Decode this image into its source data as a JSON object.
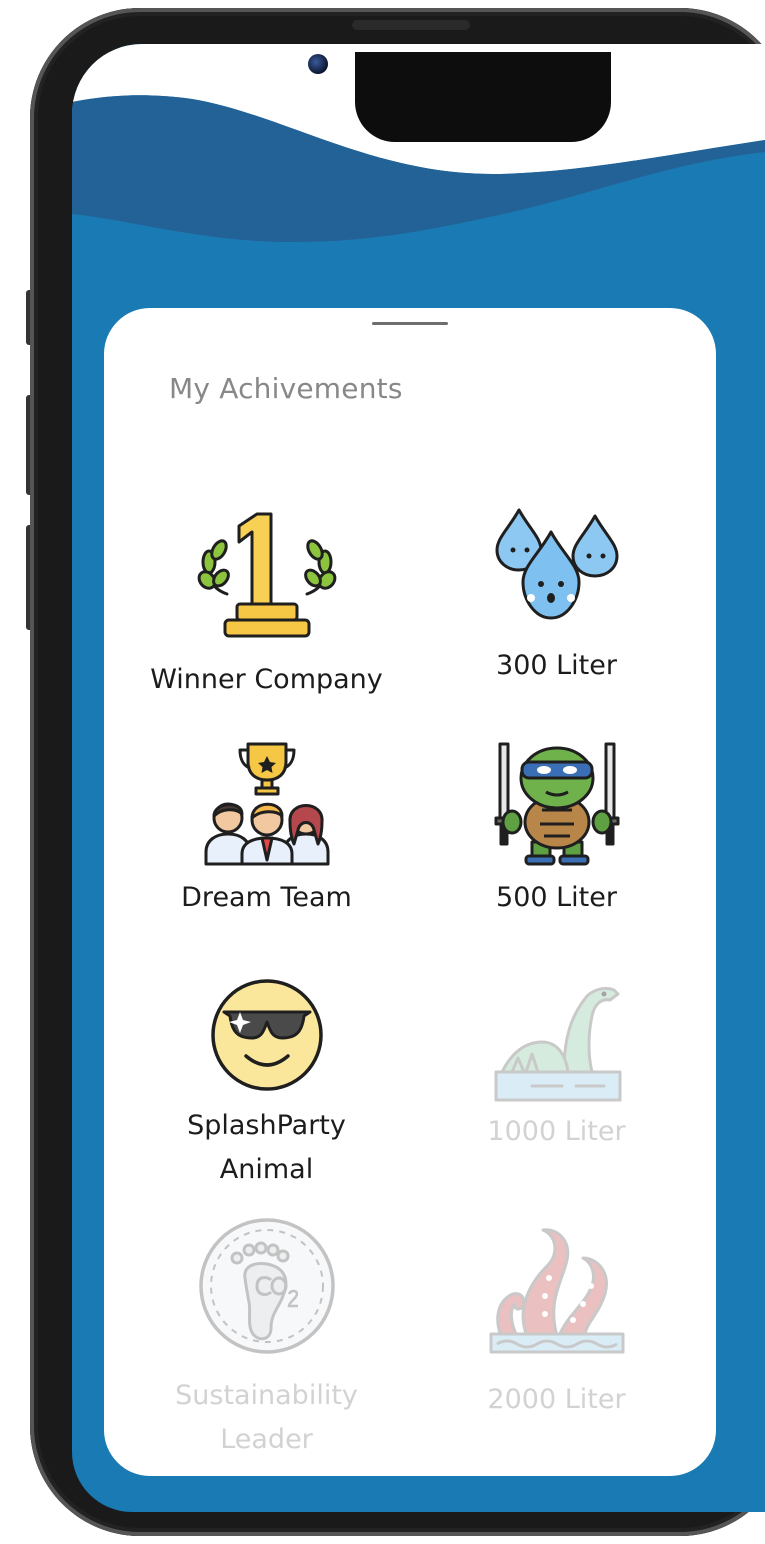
{
  "page": {
    "title": "My Achivements"
  },
  "colors": {
    "screen_blue": "#1a7ab3",
    "wave_dark": "#236296",
    "card_bg": "#ffffff",
    "label_active": "#1c1c1c",
    "label_locked": "#d2d2d2"
  },
  "achievements": [
    {
      "label": "Winner Company",
      "icon": "trophy-first-place-icon",
      "unlocked": true
    },
    {
      "label": "300 Liter",
      "icon": "water-drops-icon",
      "unlocked": true
    },
    {
      "label": "Dream Team",
      "icon": "team-trophy-icon",
      "unlocked": true
    },
    {
      "label": "500 Liter",
      "icon": "ninja-turtle-icon",
      "unlocked": true
    },
    {
      "label": "SplashParty\nAnimal",
      "icon": "sunglasses-smiley-icon",
      "unlocked": true
    },
    {
      "label": "1000 Liter",
      "icon": "sea-monster-icon",
      "unlocked": false
    },
    {
      "label": "Sustainability\nLeader",
      "icon": "co2-footprint-icon",
      "unlocked": false
    },
    {
      "label": "2000 Liter",
      "icon": "kraken-tentacles-icon",
      "unlocked": false
    }
  ]
}
